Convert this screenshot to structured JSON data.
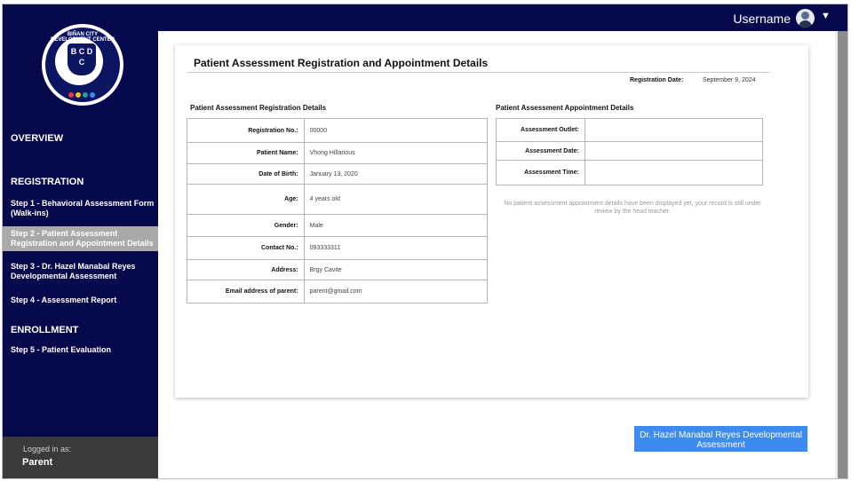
{
  "header": {
    "username": "Username"
  },
  "logo": {
    "arc_text": "BIÑAN CITY DEVELOPMENT CENTER",
    "letters": "B C D C"
  },
  "sidebar": {
    "overview": "OVERVIEW",
    "registration": "REGISTRATION",
    "items": [
      {
        "label": "Step 1 - Behavioral Assessment Form (Walk-ins)"
      },
      {
        "label": "Step 2 - Patient Assessment Registration and Appointment Details"
      },
      {
        "label": "Step 3 - Dr. Hazel Manabal Reyes Developmental Assessment"
      },
      {
        "label": "Step 4 - Assessment Report"
      },
      {
        "label": "Step 5 - Patient Evaluation"
      }
    ],
    "enrollment": "ENROLLMENT",
    "logged_in_label": "Logged in as:",
    "logged_in_role": "Parent"
  },
  "main": {
    "title": "Patient Assessment Registration and Appointment Details",
    "registration_date_label": "Registration Date:",
    "registration_date_value": "September 9, 2024",
    "registration_section": {
      "title": "Patient Assessment Registration Details",
      "rows": [
        {
          "label": "Registration No.:",
          "value": "00000"
        },
        {
          "label": "Patient Name:",
          "value": "Vhong Hillarious"
        },
        {
          "label": "Date of Birth:",
          "value": "January 13, 2020"
        },
        {
          "label": "Age:",
          "value": "4 years old"
        },
        {
          "label": "Gender:",
          "value": "Male"
        },
        {
          "label": "Contact No.:",
          "value": "093333311"
        },
        {
          "label": "Address:",
          "value": "Brgy Cavite"
        },
        {
          "label": "Email address of  parent:",
          "value": "parent@gmail.com"
        }
      ]
    },
    "appointment_section": {
      "title": "Patient Assessment Appointment Details",
      "rows": [
        {
          "label": "Assessment Outlet:",
          "value": ""
        },
        {
          "label": "Assessment Date:",
          "value": ""
        },
        {
          "label": "Assessment Time:",
          "value": ""
        }
      ],
      "note": "No patient assessment appointment details have been displayed yet, your record is still under review by the head teacher."
    }
  },
  "buttons": {
    "developmental_assessment": "Dr. Hazel Manabal Reyes  Developmental Assessment"
  },
  "colors": {
    "navy": "#060a4d",
    "active_item": "#a9a9a9",
    "button_blue": "#3d8bee"
  }
}
